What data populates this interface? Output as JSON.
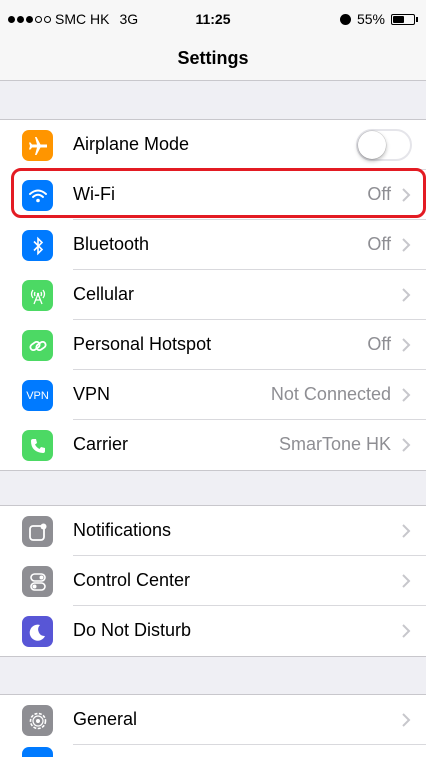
{
  "status_bar": {
    "carrier": "SMC HK",
    "network": "3G",
    "time": "11:25",
    "battery_text": "55%",
    "battery_level": 0.55,
    "signal_full_dots": 3,
    "signal_total_dots": 5
  },
  "nav": {
    "title": "Settings"
  },
  "group1": {
    "rows": [
      {
        "label": "Airplane Mode",
        "icon": "airplane-icon",
        "color": "#ff9500",
        "toggle": false
      },
      {
        "label": "Wi-Fi",
        "icon": "wifi-icon",
        "color": "#007aff",
        "detail": "Off"
      },
      {
        "label": "Bluetooth",
        "icon": "bluetooth-icon",
        "color": "#007aff",
        "detail": "Off"
      },
      {
        "label": "Cellular",
        "icon": "cellular-icon",
        "color": "#4cd964",
        "detail": ""
      },
      {
        "label": "Personal Hotspot",
        "icon": "hotspot-icon",
        "color": "#4cd964",
        "detail": "Off"
      },
      {
        "label": "VPN",
        "icon": "vpn-icon",
        "icon_text": "VPN",
        "color": "#007aff",
        "detail": "Not Connected"
      },
      {
        "label": "Carrier",
        "icon": "phone-icon",
        "color": "#4cd964",
        "detail": "SmarTone HK"
      }
    ]
  },
  "group2": {
    "rows": [
      {
        "label": "Notifications",
        "icon": "notifications-icon",
        "color": "#8e8e93"
      },
      {
        "label": "Control Center",
        "icon": "control-center-icon",
        "color": "#8e8e93"
      },
      {
        "label": "Do Not Disturb",
        "icon": "moon-icon",
        "color": "#5856d6"
      }
    ]
  },
  "group3": {
    "rows": [
      {
        "label": "General",
        "icon": "gear-icon",
        "color": "#8e8e93"
      }
    ]
  },
  "highlight_color": "#e31b23"
}
